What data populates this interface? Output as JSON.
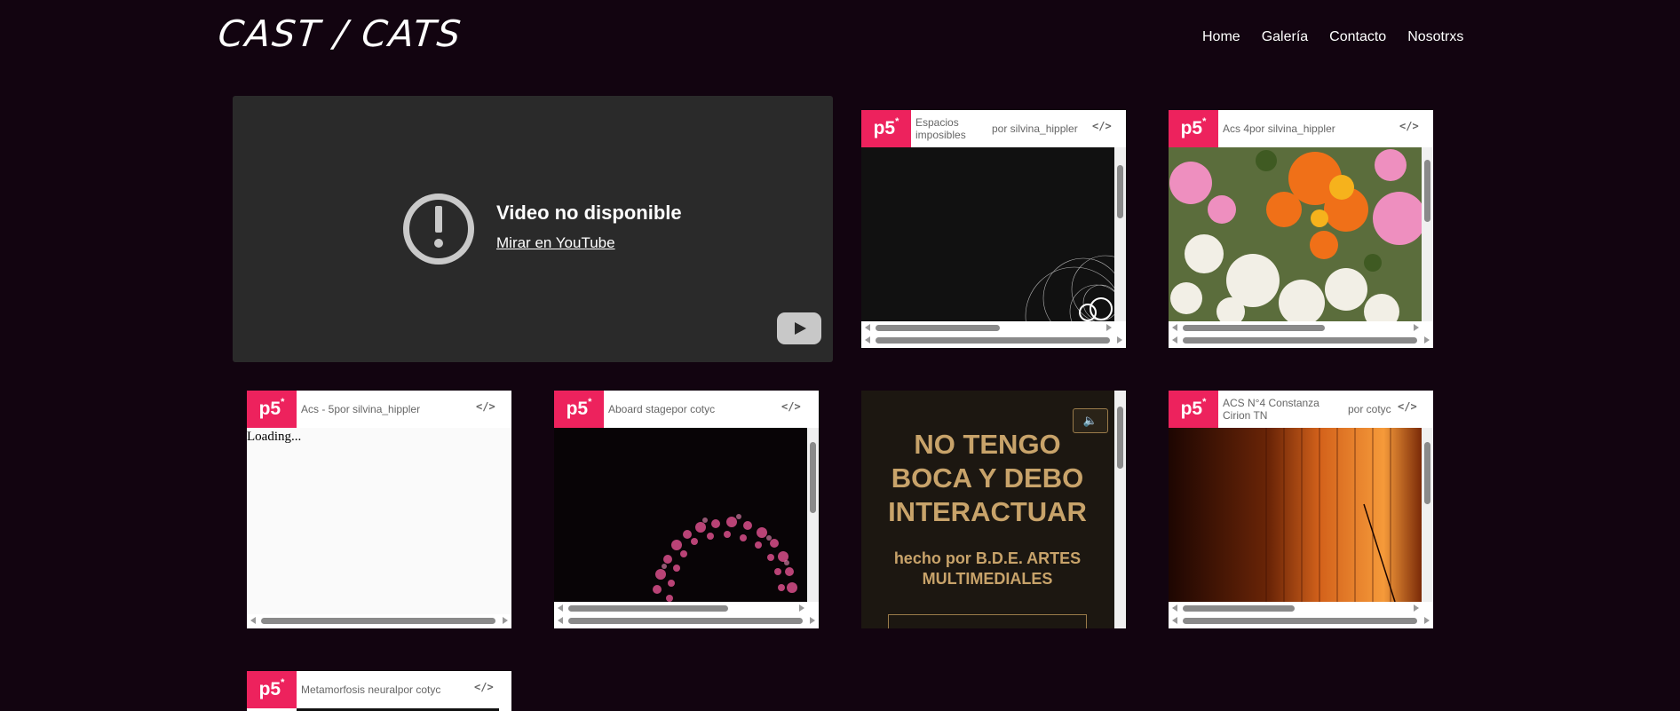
{
  "header": {
    "logo": "CAST / CATS",
    "nav": [
      "Home",
      "Galería",
      "Contacto",
      "Nosotrxs"
    ]
  },
  "video": {
    "title": "Video no disponible",
    "link": "Mirar en YouTube",
    "icon": "warning-icon"
  },
  "sketches": [
    {
      "badge": "p5*",
      "title": "Espacios imposibles",
      "by": "por silvina_hippler",
      "code": "</>"
    },
    {
      "badge": "p5*",
      "title": "Acs 4por silvina_hippler",
      "code": "</>"
    },
    {
      "badge": "p5*",
      "title": "Acs - 5por silvina_hippler",
      "code": "</>",
      "loading": "Loading..."
    },
    {
      "badge": "p5*",
      "title": "Aboard stagepor cotyc",
      "code": "</>"
    },
    {
      "badge": "p5*",
      "title": "ACS N°4 Constanza Cirion TN",
      "by": "por cotyc",
      "code": "</>"
    },
    {
      "badge": "p5*",
      "title": "Metamorfosis neuralpor cotyc",
      "code": "</>"
    }
  ],
  "poster": {
    "headline_lines": [
      "NO TENGO",
      "BOCA Y DEBO",
      "INTERACTUAR"
    ],
    "credit_lines": [
      "hecho por B.D.E. ARTES",
      "MULTIMEDIALES"
    ],
    "sound_icon": "speaker-icon"
  },
  "colors": {
    "background": "#120410",
    "p5_pink": "#ed225d",
    "poster_gold": "#c8a36a"
  }
}
